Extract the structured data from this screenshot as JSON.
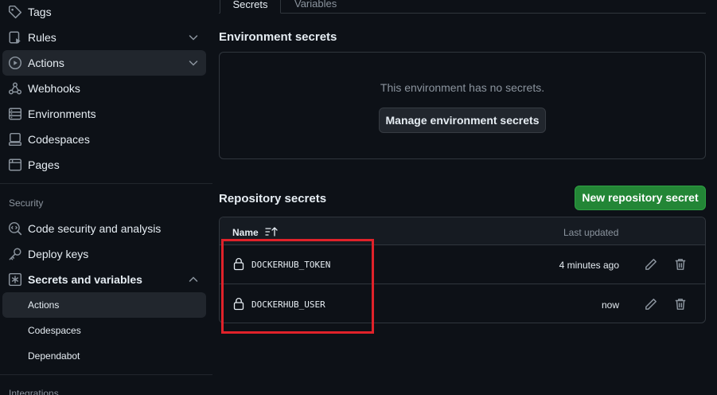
{
  "sidebar": {
    "items": [
      {
        "label": "Tags",
        "icon": "tag-icon"
      },
      {
        "label": "Rules",
        "icon": "rules-icon"
      },
      {
        "label": "Actions",
        "icon": "play-icon"
      },
      {
        "label": "Webhooks",
        "icon": "webhook-icon"
      },
      {
        "label": "Environments",
        "icon": "server-icon"
      },
      {
        "label": "Codespaces",
        "icon": "codespaces-icon"
      },
      {
        "label": "Pages",
        "icon": "browser-icon"
      }
    ],
    "security_heading": "Security",
    "security_items": [
      {
        "label": "Code security and analysis",
        "icon": "codescan-icon"
      },
      {
        "label": "Deploy keys",
        "icon": "key-icon"
      },
      {
        "label": "Secrets and variables",
        "icon": "asterisk-icon"
      }
    ],
    "secrets_sub_items": [
      {
        "label": "Actions"
      },
      {
        "label": "Codespaces"
      },
      {
        "label": "Dependabot"
      }
    ],
    "integrations_heading": "Integrations"
  },
  "tabs": [
    {
      "label": "Secrets"
    },
    {
      "label": "Variables"
    }
  ],
  "environment": {
    "heading": "Environment secrets",
    "empty_text": "This environment has no secrets.",
    "manage_button": "Manage environment secrets"
  },
  "repository": {
    "heading": "Repository secrets",
    "new_button": "New repository secret",
    "columns": {
      "name": "Name",
      "updated": "Last updated"
    },
    "rows": [
      {
        "name": "DOCKERHUB_TOKEN",
        "updated": "4 minutes ago"
      },
      {
        "name": "DOCKERHUB_USER",
        "updated": "now"
      }
    ]
  },
  "colors": {
    "background": "#0d1117",
    "accent_green": "#238636",
    "highlight_red": "#e0222a"
  }
}
